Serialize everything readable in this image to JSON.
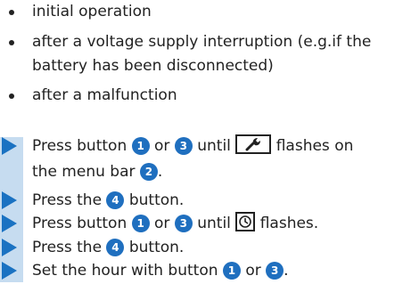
{
  "bullets": [
    {
      "line1": "initial operation"
    },
    {
      "line1": "after a voltage supply interruption (e.g.if the",
      "line2": "battery has been disconnected)"
    },
    {
      "line1": "after a malfunction"
    }
  ],
  "steps": {
    "s1": {
      "a": "Press button",
      "b": "or",
      "c": "until",
      "d": "flashes on",
      "e": "the menu bar"
    },
    "s2": {
      "a": "Press the",
      "b": "button."
    },
    "s3": {
      "a": "Press button",
      "b": "or",
      "c": "until",
      "d": "flashes."
    },
    "s4": {
      "a": "Press the",
      "b": "button."
    },
    "s5": {
      "a": "Set the hour with button",
      "b": "or"
    }
  },
  "numbers": {
    "n1": "1",
    "n2": "2",
    "n3": "3",
    "n4": "4"
  },
  "icons": {
    "wrench": "wrench-icon",
    "clock": "clock-icon",
    "arrow": "step-arrow-icon"
  },
  "colors": {
    "accent": "#1a72c2",
    "number_badge": "#1f6fbf",
    "band": "#c6dcf0"
  }
}
